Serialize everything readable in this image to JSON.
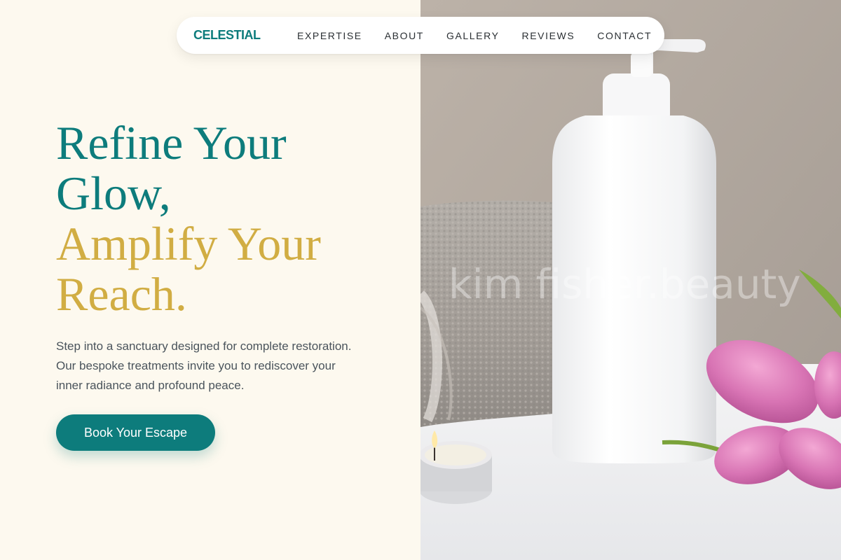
{
  "brand": {
    "name": "CELESTIAL"
  },
  "nav": {
    "items": [
      {
        "label": "EXPERTISE"
      },
      {
        "label": "ABOUT"
      },
      {
        "label": "GALLERY"
      },
      {
        "label": "REVIEWS"
      },
      {
        "label": "CONTACT"
      }
    ]
  },
  "hero": {
    "headline_line1": "Refine Your",
    "headline_line2": "Glow,",
    "headline_line3": "Amplify Your",
    "headline_line4": "Reach.",
    "intro": "Step into a sanctuary designed for complete restoration. Our bespoke treatments invite you to rediscover your inner radiance and profound peace.",
    "cta_label": "Book Your Escape",
    "watermark": "kim fisher.beauty"
  },
  "colors": {
    "accent": "#0d7c7c",
    "gold": "#d1ad43",
    "background": "#fdf9ef"
  }
}
